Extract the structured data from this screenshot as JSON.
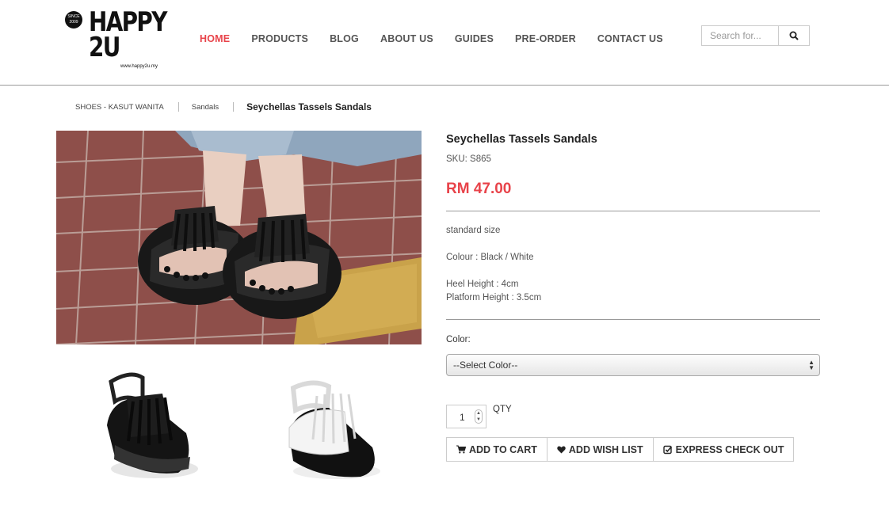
{
  "brand": {
    "logo_since": "SINCE 2009",
    "logo_line1": "HAPPY",
    "logo_line2": "2U",
    "logo_url": "www.happy2u.my"
  },
  "nav": {
    "items": [
      {
        "label": "HOME",
        "active": true
      },
      {
        "label": "PRODUCTS",
        "active": false
      },
      {
        "label": "BLOG",
        "active": false
      },
      {
        "label": "ABOUT US",
        "active": false
      },
      {
        "label": "GUIDES",
        "active": false
      },
      {
        "label": "PRE-ORDER",
        "active": false
      },
      {
        "label": "CONTACT US",
        "active": false
      }
    ],
    "active_color": "#e8434a"
  },
  "search": {
    "placeholder": "Search for...",
    "icon": "search-icon"
  },
  "breadcrumb": {
    "items": [
      "SHOES - KASUT WANITA",
      "Sandals"
    ],
    "current": "Seychellas Tassels Sandals"
  },
  "product": {
    "title": "Seychellas Tassels Sandals",
    "sku": "SKU: S865",
    "price": "RM 47.00",
    "price_color": "#e8434a",
    "description": {
      "size": "standard size",
      "colour": "Colour : Black / White",
      "heel": "Heel Height : 4cm",
      "platform": "Platform Height : 3.5cm"
    }
  },
  "options": {
    "color_label": "Color:",
    "color_selected": "--Select Color--"
  },
  "quantity": {
    "value": "1",
    "label": "QTY"
  },
  "actions": {
    "add_to_cart": "ADD TO CART",
    "add_wish_list": "ADD WISH LIST",
    "express_checkout": "EXPRESS CHECK OUT"
  }
}
